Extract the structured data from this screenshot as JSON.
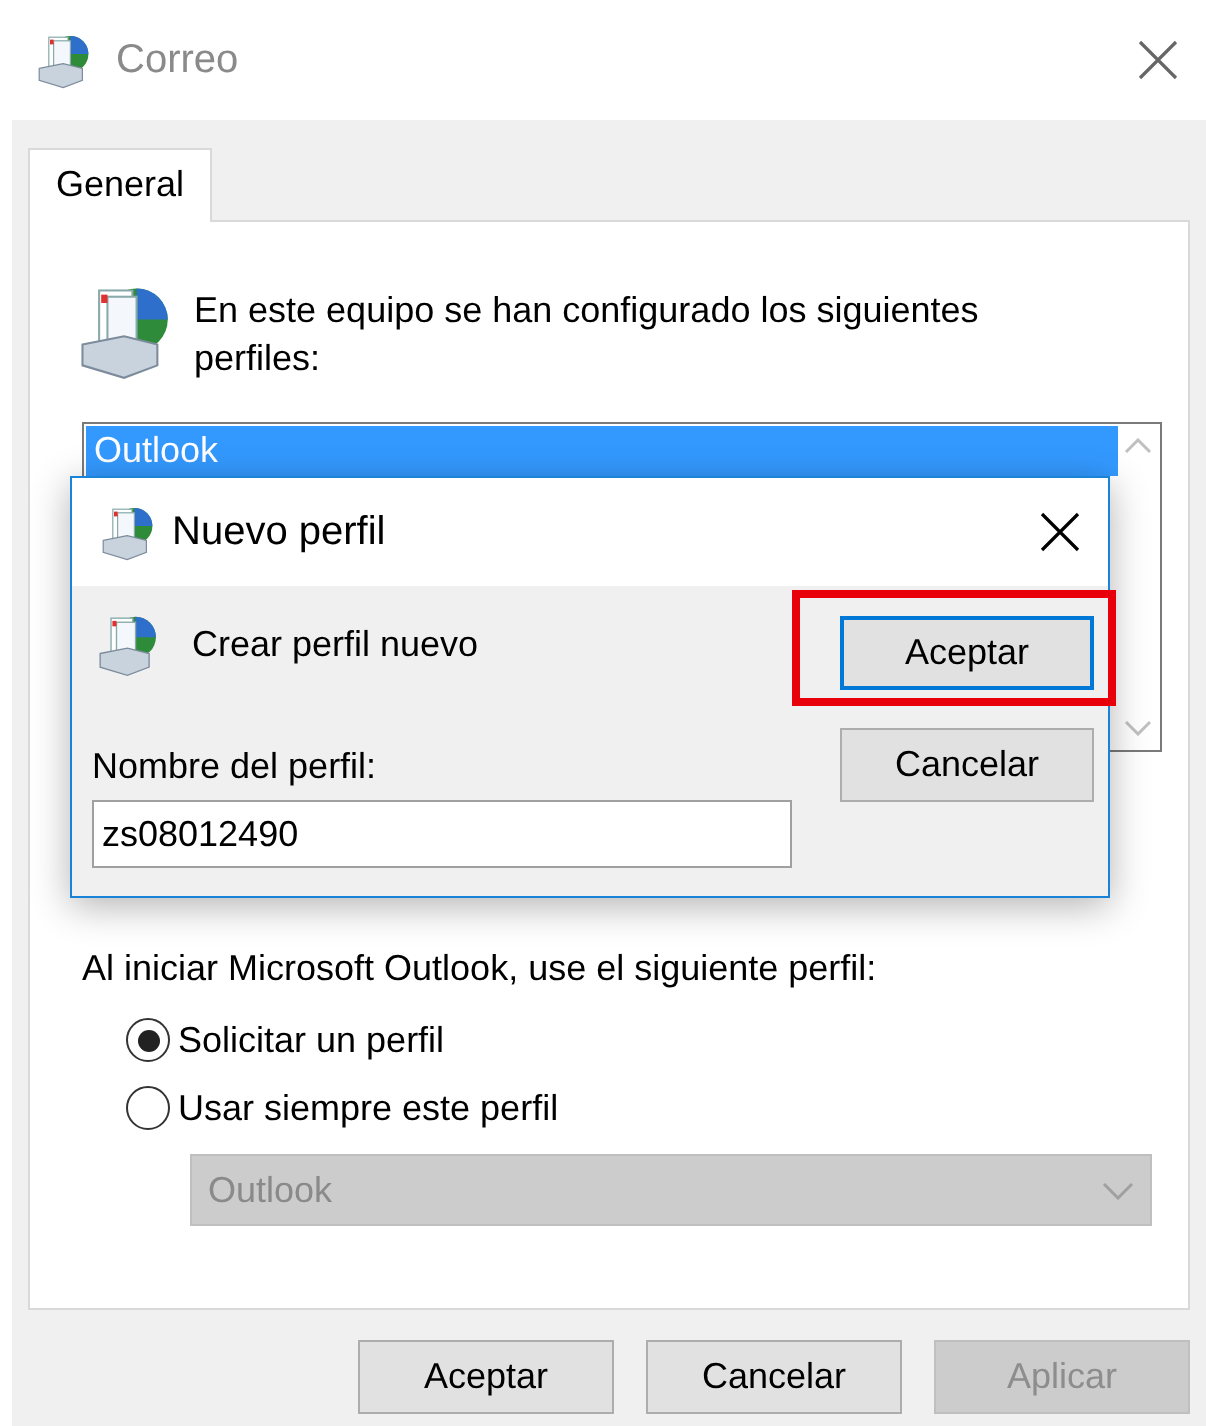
{
  "window": {
    "title": "Correo"
  },
  "tabs": [
    {
      "label": "General",
      "selected": true
    }
  ],
  "intro": "En este equipo se han configurado los siguientes perfiles:",
  "profiles": [
    {
      "name": "Outlook",
      "selected": true
    }
  ],
  "startup": {
    "label": "Al iniciar Microsoft Outlook, use el siguiente perfil:",
    "options": [
      {
        "label": "Solicitar un perfil",
        "selected": true
      },
      {
        "label": "Usar siempre este perfil",
        "selected": false
      }
    ],
    "profile_select": {
      "value": "Outlook",
      "disabled": true
    }
  },
  "buttons": [
    {
      "label": "Aceptar",
      "disabled": false
    },
    {
      "label": "Cancelar",
      "disabled": false
    },
    {
      "label": "Aplicar",
      "disabled": true
    }
  ],
  "dialog": {
    "title": "Nuevo perfil",
    "message": "Crear perfil nuevo",
    "field": {
      "label": "Nombre del perfil:",
      "value": "zs08012490"
    },
    "buttons": [
      {
        "label": "Aceptar",
        "default": true,
        "highlighted": true
      },
      {
        "label": "Cancelar",
        "default": false,
        "highlighted": false
      }
    ]
  }
}
